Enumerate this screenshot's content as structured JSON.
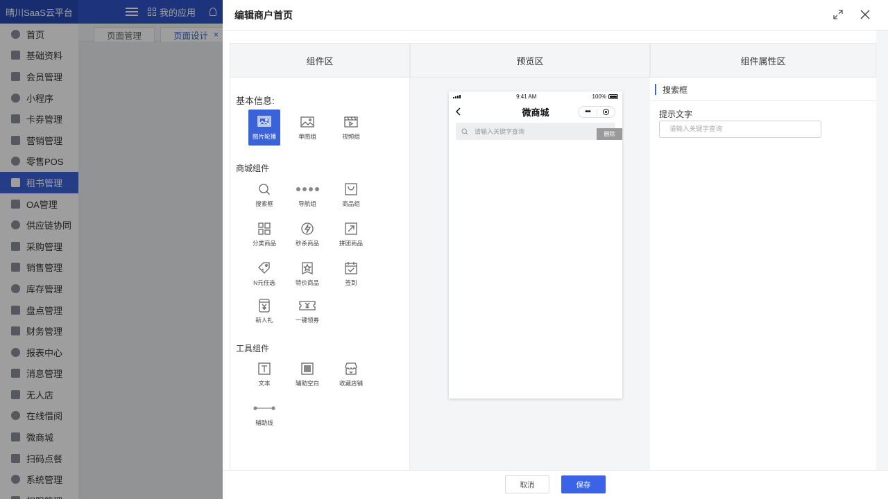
{
  "app": {
    "brand": "晴川SaaS云平台",
    "my_apps": "我的应用"
  },
  "sidebar": {
    "items": [
      {
        "label": "首页",
        "icon": "home-icon"
      },
      {
        "label": "基础资料",
        "icon": "layers-icon"
      },
      {
        "label": "会员管理",
        "icon": "user-icon"
      },
      {
        "label": "小程序",
        "icon": "mini-program-icon"
      },
      {
        "label": "卡券管理",
        "icon": "ticket-icon"
      },
      {
        "label": "营销管理",
        "icon": "bar-chart-icon"
      },
      {
        "label": "零售POS",
        "icon": "monitor-icon"
      },
      {
        "label": "租书管理",
        "icon": "book-icon",
        "active": true
      },
      {
        "label": "OA管理",
        "icon": "files-icon"
      },
      {
        "label": "供应链协同",
        "icon": "network-icon"
      },
      {
        "label": "采购管理",
        "icon": "cart-icon"
      },
      {
        "label": "销售管理",
        "icon": "chart-box-icon"
      },
      {
        "label": "库存管理",
        "icon": "warehouse-icon"
      },
      {
        "label": "盘点管理",
        "icon": "cube-icon"
      },
      {
        "label": "财务管理",
        "icon": "finance-icon"
      },
      {
        "label": "报表中心",
        "icon": "report-icon"
      },
      {
        "label": "消息管理",
        "icon": "bell-icon"
      },
      {
        "label": "无人店",
        "icon": "store-icon"
      },
      {
        "label": "在线借阅",
        "icon": "books-icon"
      },
      {
        "label": "微商城",
        "icon": "shop-icon"
      },
      {
        "label": "扫码点餐",
        "icon": "dish-icon"
      },
      {
        "label": "系统管理",
        "icon": "gear-icon"
      },
      {
        "label": "权限管理",
        "icon": "lock-icon"
      }
    ]
  },
  "tabs": [
    {
      "label": "页面管理"
    },
    {
      "label": "页面设计",
      "close": "×"
    }
  ],
  "drawer": {
    "title": "编辑商户首页",
    "columns": {
      "components": "组件区",
      "preview": "预览区",
      "properties": "组件属性区"
    },
    "sections": {
      "basic": "基本信息:",
      "mall": "商城组件",
      "tools": "工具组件"
    },
    "basic_components": [
      {
        "label": "图片轮播",
        "icon": "image-carousel-icon",
        "selected": true
      },
      {
        "label": "单图组",
        "icon": "image-icon"
      },
      {
        "label": "视频组",
        "icon": "video-icon"
      }
    ],
    "mall_components": [
      {
        "label": "搜索框",
        "icon": "search-icon"
      },
      {
        "label": "导航组",
        "icon": "nav-dots-icon"
      },
      {
        "label": "商品组",
        "icon": "product-box-icon"
      },
      {
        "label": "分类商品",
        "icon": "category-icon"
      },
      {
        "label": "秒杀商品",
        "icon": "lightning-icon"
      },
      {
        "label": "拼团商品",
        "icon": "group-buy-icon"
      },
      {
        "label": "N元任选",
        "icon": "price-tag-icon"
      },
      {
        "label": "特价商品",
        "icon": "star-tag-icon"
      },
      {
        "label": "签到",
        "icon": "calendar-check-icon"
      },
      {
        "label": "新人礼",
        "icon": "gift-icon"
      },
      {
        "label": "一键领券",
        "icon": "coupon-icon"
      }
    ],
    "tool_components": [
      {
        "label": "文本",
        "icon": "text-icon"
      },
      {
        "label": "辅助空白",
        "icon": "blank-icon"
      },
      {
        "label": "收藏店铺",
        "icon": "store-fav-icon"
      },
      {
        "label": "辅助线",
        "icon": "line-icon"
      }
    ],
    "preview": {
      "time": "9:41 AM",
      "battery": "100%",
      "page_title": "微商城",
      "search_placeholder": "请输入关键字查询",
      "delete_label": "删除"
    },
    "props": {
      "section_title": "搜索框",
      "hint_label": "提示文字",
      "hint_placeholder": "请输入关键字查询"
    },
    "footer": {
      "cancel": "取消",
      "save": "保存"
    }
  },
  "colors": {
    "primary": "#3a63d8",
    "topbar": "#2f54c9",
    "save_button": "#3a63e8"
  }
}
